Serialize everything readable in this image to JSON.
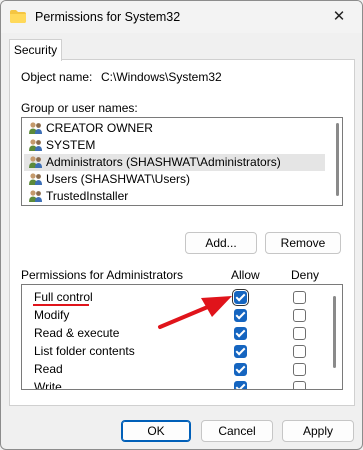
{
  "window": {
    "title": "Permissions for System32",
    "close_glyph": "✕"
  },
  "tabs": [
    {
      "label": "Security"
    }
  ],
  "object_name": {
    "label": "Object name:",
    "value": "C:\\Windows\\System32"
  },
  "group_section": {
    "label": "Group or user names:"
  },
  "users": [
    {
      "name": "CREATOR OWNER",
      "icon": "users-icon",
      "selected": false
    },
    {
      "name": "SYSTEM",
      "icon": "users-icon",
      "selected": false
    },
    {
      "name": "Administrators (SHASHWAT\\Administrators)",
      "icon": "users-icon",
      "selected": true
    },
    {
      "name": "Users (SHASHWAT\\Users)",
      "icon": "users-icon",
      "selected": false
    },
    {
      "name": "TrustedInstaller",
      "icon": "users-icon",
      "selected": false
    }
  ],
  "list_buttons": {
    "add": "Add...",
    "remove": "Remove"
  },
  "permissions": {
    "header": "Permissions for Administrators",
    "allow_label": "Allow",
    "deny_label": "Deny",
    "rows": [
      {
        "name": "Full control",
        "allow": true,
        "deny": false
      },
      {
        "name": "Modify",
        "allow": true,
        "deny": false
      },
      {
        "name": "Read & execute",
        "allow": true,
        "deny": false
      },
      {
        "name": "List folder contents",
        "allow": true,
        "deny": false
      },
      {
        "name": "Read",
        "allow": true,
        "deny": false
      },
      {
        "name": "Write",
        "allow": true,
        "deny": false
      }
    ]
  },
  "footer_buttons": {
    "ok": "OK",
    "cancel": "Cancel",
    "apply": "Apply"
  },
  "colors": {
    "accent": "#005fb8",
    "checkbox": "#1565c0",
    "annotation": "#e0141b"
  }
}
